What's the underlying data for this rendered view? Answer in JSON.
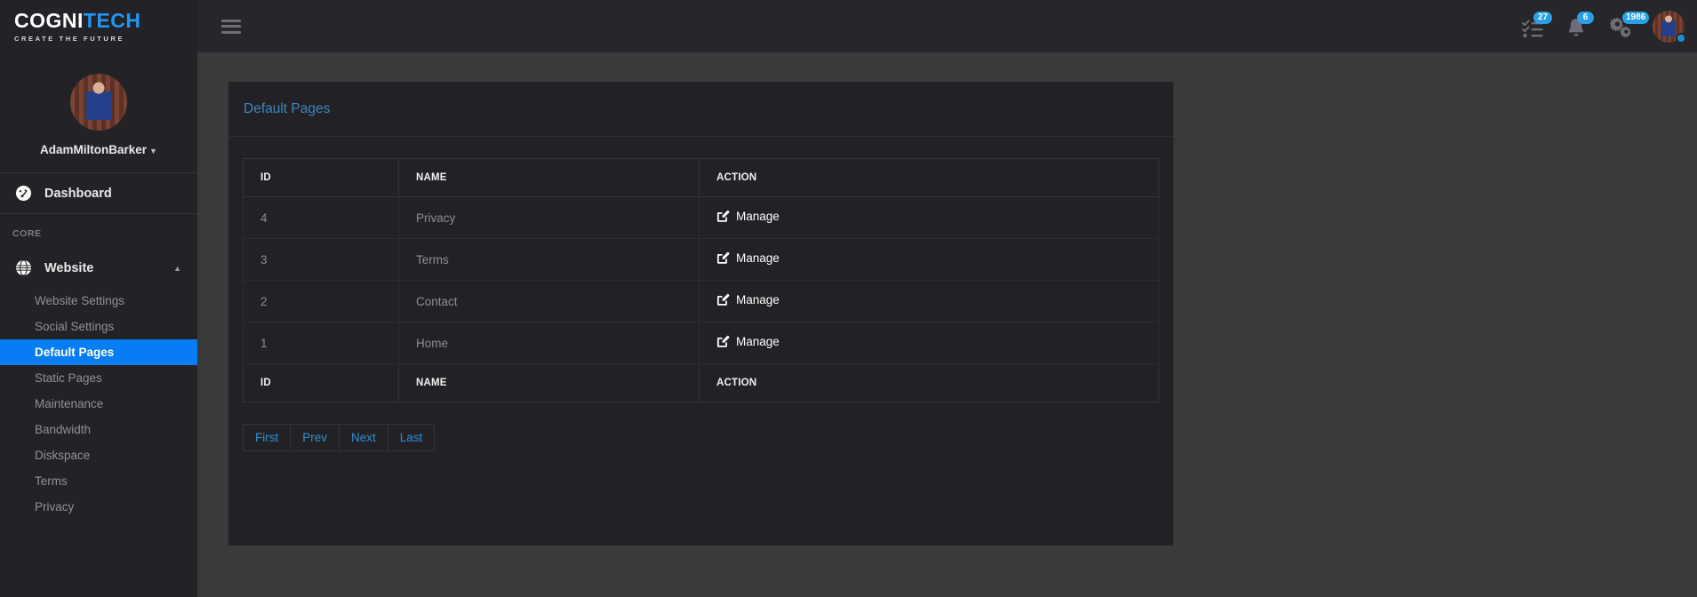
{
  "topbar": {
    "brand_primary": "COGNI",
    "brand_accent": "TECH",
    "brand_tagline": "CREATE THE FUTURE",
    "menu_toggle_name": "hamburger-menu",
    "tasks_badge": "27",
    "notifications_badge": "6",
    "settings_badge": "1986"
  },
  "sidebar": {
    "user_name": "AdamMiltonBarker",
    "dashboard_label": "Dashboard",
    "section_label": "CORE",
    "group_label": "Website",
    "items": [
      {
        "label": "Website Settings",
        "active": false
      },
      {
        "label": "Social Settings",
        "active": false
      },
      {
        "label": "Default Pages",
        "active": true
      },
      {
        "label": "Static Pages",
        "active": false
      },
      {
        "label": "Maintenance",
        "active": false
      },
      {
        "label": "Bandwidth",
        "active": false
      },
      {
        "label": "Diskspace",
        "active": false
      },
      {
        "label": "Terms",
        "active": false
      },
      {
        "label": "Privacy",
        "active": false
      }
    ]
  },
  "card": {
    "title": "Default Pages",
    "table": {
      "headers": [
        "ID",
        "NAME",
        "ACTION"
      ],
      "footers": [
        "ID",
        "NAME",
        "ACTION"
      ],
      "action_label": "Manage",
      "rows": [
        {
          "id": "4",
          "name": "Privacy",
          "action": "Manage"
        },
        {
          "id": "3",
          "name": "Terms",
          "action": "Manage"
        },
        {
          "id": "2",
          "name": "Contact",
          "action": "Manage"
        },
        {
          "id": "1",
          "name": "Home",
          "action": "Manage"
        }
      ]
    },
    "pagination": [
      "First",
      "Prev",
      "Next",
      "Last"
    ]
  },
  "colors": {
    "accent_blue": "#067cf5",
    "badge_blue": "#27a0e8",
    "link_blue": "#2f8fd4",
    "title_blue": "#3f86b8",
    "sidebar_bg": "#232327",
    "card_bg": "#222226",
    "page_bg": "#3a3a3a"
  }
}
